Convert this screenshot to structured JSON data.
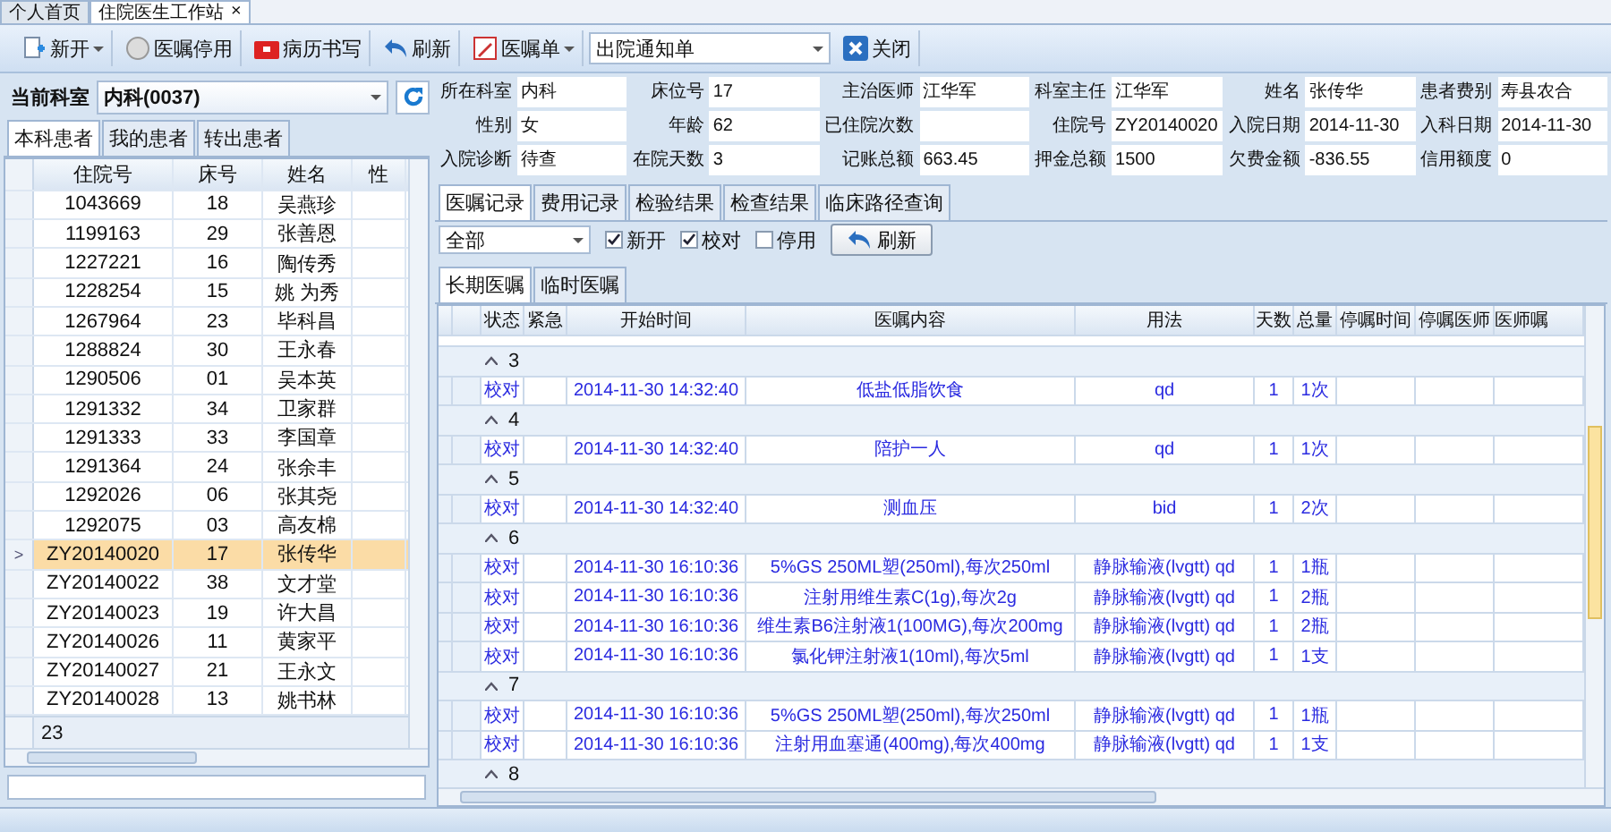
{
  "doc_tabs": [
    {
      "label": "个人首页",
      "selected": false
    },
    {
      "label": "住院医生工作站",
      "selected": true,
      "close": "×"
    }
  ],
  "toolbar": [
    {
      "kind": "dropdown",
      "label": "新开"
    },
    {
      "kind": "button",
      "label": "医嘱停用"
    },
    {
      "kind": "button",
      "label": "病历书写"
    },
    {
      "kind": "button",
      "label": "刷新"
    },
    {
      "kind": "dropdown",
      "label": "医嘱单"
    },
    {
      "kind": "select",
      "label": "出院通知单"
    },
    {
      "kind": "button",
      "label": "关闭"
    }
  ],
  "department": {
    "label": "当前科室",
    "value": "内科(0037)"
  },
  "patient_tabs": [
    {
      "label": "本科患者",
      "selected": true
    },
    {
      "label": "我的患者",
      "selected": false
    },
    {
      "label": "转出患者",
      "selected": false
    }
  ],
  "patient_columns": [
    "住院号",
    "床号",
    "姓名",
    "性"
  ],
  "patients": [
    {
      "id": "1043669",
      "bed": "18",
      "name": "吴燕珍",
      "selected": false
    },
    {
      "id": "1199163",
      "bed": "29",
      "name": "张善恩",
      "selected": false
    },
    {
      "id": "1227221",
      "bed": "16",
      "name": "陶传秀",
      "selected": false
    },
    {
      "id": "1228254",
      "bed": "15",
      "name": "姚 为秀",
      "selected": false
    },
    {
      "id": "1267964",
      "bed": "23",
      "name": "毕科昌",
      "selected": false
    },
    {
      "id": "1288824",
      "bed": "30",
      "name": "王永春",
      "selected": false
    },
    {
      "id": "1290506",
      "bed": "01",
      "name": "吴本英",
      "selected": false
    },
    {
      "id": "1291332",
      "bed": "34",
      "name": "卫家群",
      "selected": false
    },
    {
      "id": "1291333",
      "bed": "33",
      "name": "李国章",
      "selected": false
    },
    {
      "id": "1291364",
      "bed": "24",
      "name": "张余丰",
      "selected": false
    },
    {
      "id": "1292026",
      "bed": "06",
      "name": "张其尧",
      "selected": false
    },
    {
      "id": "1292075",
      "bed": "03",
      "name": "高友棉",
      "selected": false
    },
    {
      "id": "ZY20140020",
      "bed": "17",
      "name": "张传华",
      "selected": true,
      "marker": ">"
    },
    {
      "id": "ZY20140022",
      "bed": "38",
      "name": "文才堂",
      "selected": false
    },
    {
      "id": "ZY20140023",
      "bed": "19",
      "name": "许大昌",
      "selected": false
    },
    {
      "id": "ZY20140026",
      "bed": "11",
      "name": "黄家平",
      "selected": false
    },
    {
      "id": "ZY20140027",
      "bed": "21",
      "name": "王永文",
      "selected": false
    },
    {
      "id": "ZY20140028",
      "bed": "13",
      "name": "姚书林",
      "selected": false
    }
  ],
  "patient_count": "23",
  "info": [
    [
      {
        "label": "所在科室",
        "value": "内科"
      },
      {
        "label": "床位号",
        "value": "17"
      },
      {
        "label": "主治医师",
        "value": "江华军"
      },
      {
        "label": "科室主任",
        "value": "江华军"
      },
      {
        "label": "姓名",
        "value": "张传华"
      },
      {
        "label": "患者费别",
        "value": "寿县农合"
      }
    ],
    [
      {
        "label": "性别",
        "value": "女"
      },
      {
        "label": "年龄",
        "value": "62"
      },
      {
        "label": "已住院次数"
      },
      {
        "label": "住院号",
        "value": "ZY20140020"
      },
      {
        "label": "入院日期",
        "value": "2014-11-30"
      },
      {
        "label": "入科日期",
        "value": "2014-11-30"
      }
    ],
    [
      {
        "label": "入院诊断",
        "value": "待查"
      },
      {
        "label": "在院天数",
        "value": "3"
      },
      {
        "label": "记账总额",
        "value": "663.45"
      },
      {
        "label": "押金总额",
        "value": "1500"
      },
      {
        "label": "欠费金额",
        "value": "-836.55"
      },
      {
        "label": "信用额度",
        "value": "0"
      }
    ]
  ],
  "record_tabs": [
    {
      "label": "医嘱记录",
      "selected": true
    },
    {
      "label": "费用记录",
      "selected": false
    },
    {
      "label": "检验结果",
      "selected": false
    },
    {
      "label": "检查结果",
      "selected": false
    },
    {
      "label": "临床路径查询",
      "selected": false
    }
  ],
  "filter": {
    "select": "全部",
    "checks": [
      {
        "label": "新开",
        "checked": true
      },
      {
        "label": "校对",
        "checked": true
      },
      {
        "label": "停用",
        "checked": false
      }
    ],
    "refresh": "刷新"
  },
  "order_tabs": [
    {
      "label": "长期医嘱",
      "selected": true
    },
    {
      "label": "临时医嘱",
      "selected": false
    }
  ],
  "order_columns": [
    "状态",
    "紧急",
    "开始时间",
    "医嘱内容",
    "用法",
    "天数",
    "总量",
    "停嘱时间",
    "停嘱医师",
    "医师嘱"
  ],
  "order_groups": [
    {
      "group": "3",
      "expanded": true,
      "rows": [
        [
          "校对",
          "",
          "2014-11-30 14:32:40",
          "低盐低脂饮食",
          "qd",
          "1",
          "1次"
        ]
      ]
    },
    {
      "group": "4",
      "expanded": true,
      "rows": [
        [
          "校对",
          "",
          "2014-11-30 14:32:40",
          "陪护一人",
          "qd",
          "1",
          "1次"
        ]
      ]
    },
    {
      "group": "5",
      "expanded": true,
      "rows": [
        [
          "校对",
          "",
          "2014-11-30 14:32:40",
          "测血压",
          "bid",
          "1",
          "2次"
        ]
      ]
    },
    {
      "group": "6",
      "expanded": true,
      "rows": [
        [
          "校对",
          "",
          "2014-11-30 16:10:36",
          "5%GS 250ML塑(250ml),每次250ml",
          "静脉输液(lvgtt) qd",
          "1",
          "1瓶"
        ],
        [
          "校对",
          "",
          "2014-11-30 16:10:36",
          "注射用维生素C(1g),每次2g",
          "静脉输液(lvgtt) qd",
          "1",
          "2瓶"
        ],
        [
          "校对",
          "",
          "2014-11-30 16:10:36",
          "维生素B6注射液1(100MG),每次200mg",
          "静脉输液(lvgtt) qd",
          "1",
          "2瓶"
        ],
        [
          "校对",
          "",
          "2014-11-30 16:10:36",
          "氯化钾注射液1(10ml),每次5ml",
          "静脉输液(lvgtt) qd",
          "1",
          "1支"
        ]
      ]
    },
    {
      "group": "7",
      "expanded": true,
      "rows": [
        [
          "校对",
          "",
          "2014-11-30 16:10:36",
          "5%GS 250ML塑(250ml),每次250ml",
          "静脉输液(lvgtt) qd",
          "1",
          "1瓶"
        ],
        [
          "校对",
          "",
          "2014-11-30 16:10:36",
          "注射用血塞通(400mg),每次400mg",
          "静脉输液(lvgtt) qd",
          "1",
          "1支"
        ]
      ]
    },
    {
      "group": "8",
      "expanded": true
    }
  ]
}
